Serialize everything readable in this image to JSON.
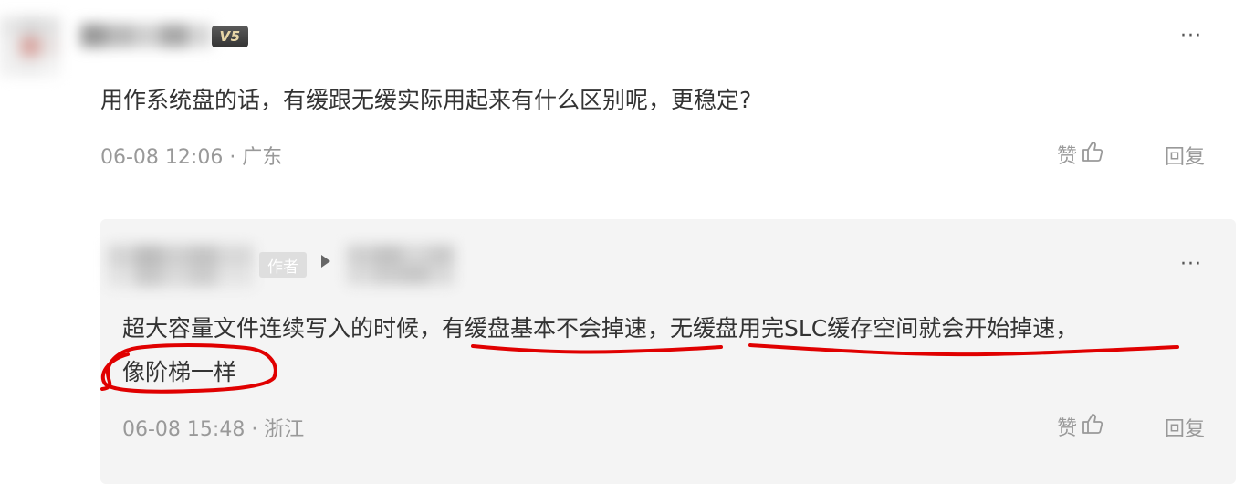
{
  "comment": {
    "badge": "V5",
    "text": "用作系统盘的话，有缓跟无缓实际用起来有什么区别呢，更稳定?",
    "meta": "06-08 12:06 · 广东",
    "like_label": "赞",
    "reply_label": "回复",
    "more_label": "···"
  },
  "reply": {
    "author_tag": "作者",
    "line1": "超大容量文件连续写入的时候，有缓盘基本不会掉速，无缓盘用完SLC缓存空间就会开始掉速，",
    "line2": "像阶梯一样",
    "meta": "06-08 15:48 · 浙江",
    "like_label": "赞",
    "reply_label": "回复",
    "more_label": "···"
  },
  "colors": {
    "annotation": "#e00000",
    "muted_text": "#999999",
    "reply_background": "#f4f4f4"
  }
}
